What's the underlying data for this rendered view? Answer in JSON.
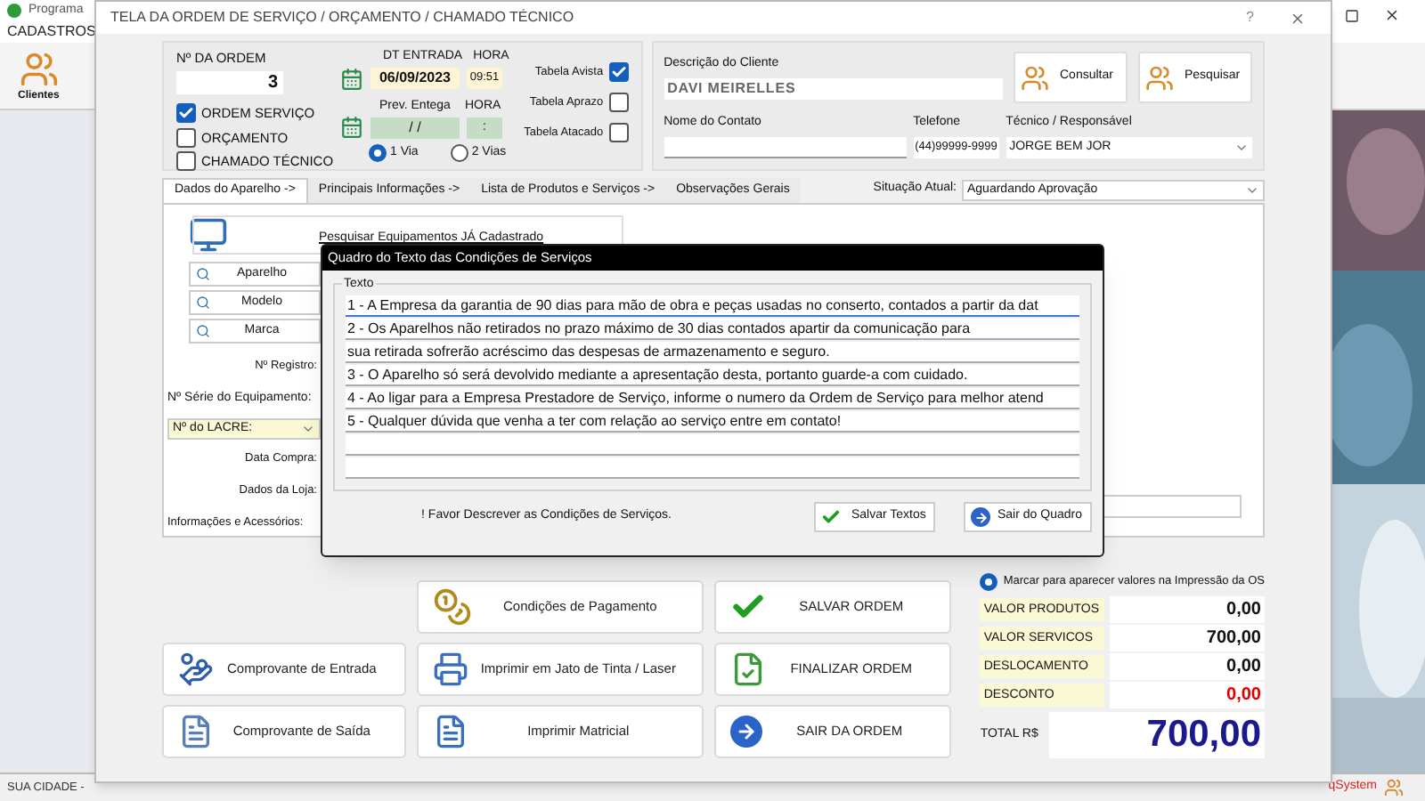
{
  "app": {
    "title": "Programa",
    "menu": [
      "CADASTROS"
    ],
    "toolbar": [
      {
        "label": "Clientes"
      }
    ],
    "status_bar": {
      "city": "SUA CIDADE -",
      "brand": "qSystem"
    }
  },
  "window": {
    "title": "TELA DA ORDEM DE SERVIÇO / ORÇAMENTO / CHAMADO TÉCNICO",
    "help": "?"
  },
  "order": {
    "label": "Nº DA ORDEM",
    "value": "3",
    "types": [
      {
        "label": "ORDEM SERVIÇO",
        "checked": true
      },
      {
        "label": "ORÇAMENTO",
        "checked": false
      },
      {
        "label": "CHAMADO TÉCNICO",
        "checked": false
      }
    ]
  },
  "dates": {
    "entry_label": "DT ENTRADA",
    "entry": "06/09/2023",
    "hour_label": "HORA",
    "hour": "09:51",
    "delivery_label": "Prev. Entega",
    "delivery": "/ /",
    "delivery_hour_label": "HORA",
    "delivery_hour": ":",
    "vias": [
      {
        "label": "1 Via",
        "selected": true
      },
      {
        "label": "2 Vias",
        "selected": false
      }
    ]
  },
  "price_tables": [
    {
      "label": "Tabela Avista",
      "checked": true
    },
    {
      "label": "Tabela Aprazo",
      "checked": false
    },
    {
      "label": "Tabela Atacado",
      "checked": false
    }
  ],
  "client": {
    "label": "Descrição do Cliente",
    "value": "DAVI MEIRELLES",
    "buttons": [
      "Consultar",
      "Pesquisar"
    ],
    "contact_label": "Nome do Contato",
    "phone_label": "Telefone",
    "phone": "(44)99999-9999",
    "tech_label": "Técnico / Responsável",
    "tech": "JORGE BEM JOR"
  },
  "tabs": [
    {
      "label": "Dados do Aparelho ->",
      "selected": true
    },
    {
      "label": "Principais Informações ->",
      "selected": false
    },
    {
      "label": "Lista de Produtos e Serviços ->",
      "selected": false
    },
    {
      "label": "Observações Gerais",
      "selected": false
    }
  ],
  "status": {
    "label": "Situação Atual:",
    "value": "Aguardando Aprovação"
  },
  "device": {
    "search": "Pesquisar Equipamentos JÁ Cadastrado",
    "lookups": [
      "Aparelho",
      "Modelo",
      "Marca"
    ],
    "registro": "Nº Registro:",
    "serie": "Nº Série do Equipamento:",
    "seal": "Nº do LACRE:",
    "compra": "Data Compra:",
    "loja": "Dados da Loja:",
    "info": "Informações e Acessórios:"
  },
  "dialog": {
    "title": "Quadro do Texto das Condições de Serviços",
    "group": "Texto",
    "lines": [
      "1 - A Empresa da garantia de 90 dias para mão de obra e peças usadas no conserto, contados  a partir da dat",
      "2 - Os Aparelhos não retirados no prazo máximo de 30 dias contados apartir da comunicação para",
      "sua retirada sofrerão acréscimo das despesas de armazenamento e seguro.",
      "3 - O Aparelho só será devolvido mediante a apresentação desta, portanto guarde-a com cuidado.",
      "4 - Ao ligar para a Empresa Prestadore de Serviço, informe o numero da Ordem de Serviço para melhor atend",
      "5 - Qualquer dúvida que venha a ter com relação ao serviço entre em contato!"
    ],
    "note": "! Favor Descrever as Condições de Serviços.",
    "save": "Salvar Textos",
    "exit": "Sair do Quadro"
  },
  "actions": [
    [
      {
        "label": "Comprovante de Entrada",
        "kind": "receipt-in"
      },
      {
        "label": "Comprovante de Saída",
        "kind": "receipt-out"
      }
    ],
    [
      {
        "label": "Condições de Pagamento",
        "kind": "coins"
      },
      {
        "label": "Imprimir em Jato de Tinta / Laser",
        "kind": "printer"
      },
      {
        "label": "Imprimir Matricial",
        "kind": "document"
      }
    ],
    [
      {
        "label": "SALVAR ORDEM",
        "kind": "check"
      },
      {
        "label": "FINALIZAR ORDEM",
        "kind": "finish"
      },
      {
        "label": "SAIR DA ORDEM",
        "kind": "exit"
      }
    ]
  ],
  "totals": {
    "show_values": {
      "label": "Marcar para aparecer valores na Impressão da OS",
      "selected": true
    },
    "rows": [
      {
        "label": "VALOR PRODUTOS",
        "value": "0,00",
        "kind": "amount"
      },
      {
        "label": "VALOR SERVICOS",
        "value": "700,00",
        "kind": "amount"
      },
      {
        "label": "DESLOCAMENTO",
        "value": "0,00",
        "kind": "amount"
      },
      {
        "label": "DESCONTO",
        "value": "0,00",
        "kind": "discount"
      }
    ],
    "total_label": "TOTAL R$",
    "total": "700,00"
  }
}
